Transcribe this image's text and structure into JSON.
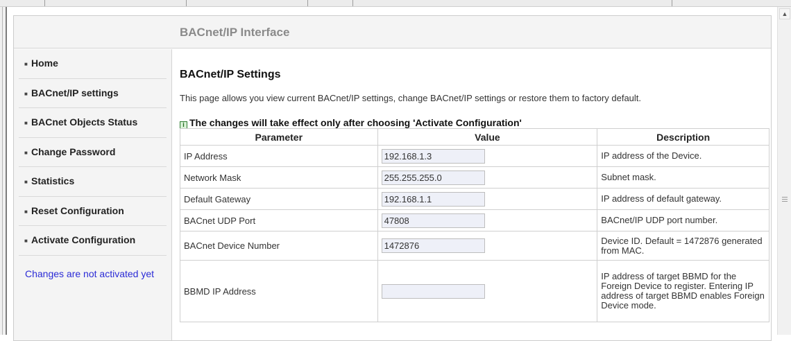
{
  "header": {
    "title": "BACnet/IP Interface"
  },
  "sidebar": {
    "items": [
      {
        "label": "Home"
      },
      {
        "label": "BACnet/IP settings"
      },
      {
        "label": "BACnet Objects Status"
      },
      {
        "label": "Change Password"
      },
      {
        "label": "Statistics"
      },
      {
        "label": "Reset Configuration"
      },
      {
        "label": "Activate Configuration"
      }
    ],
    "status_note": "Changes are not activated yet"
  },
  "main": {
    "section_title": "BACnet/IP Settings",
    "intro": "This page allows you view current BACnet/IP settings, change BACnet/IP settings or restore them to factory default.",
    "notice_icon": "i",
    "notice": "The changes will take effect only after choosing 'Activate Configuration'",
    "table": {
      "headers": {
        "parameter": "Parameter",
        "value": "Value",
        "description": "Description"
      },
      "rows": [
        {
          "parameter": "IP Address",
          "value": "192.168.1.3",
          "description": "IP address of the Device."
        },
        {
          "parameter": "Network Mask",
          "value": "255.255.255.0",
          "description": "Subnet mask."
        },
        {
          "parameter": "Default Gateway",
          "value": "192.168.1.1",
          "description": "IP address of default gateway."
        },
        {
          "parameter": "BACnet UDP Port",
          "value": "47808",
          "description": "BACnet/IP UDP port number."
        },
        {
          "parameter": "BACnet Device Number",
          "value": "1472876",
          "description": "Device ID. Default = 1472876 generated from MAC."
        },
        {
          "parameter": "BBMD IP Address",
          "value": "",
          "description": "IP address of target BBMD for the Foreign Device to register. Entering IP address of target BBMD enables Foreign Device mode."
        }
      ]
    }
  },
  "icons": {
    "scroll_up": "chevron-up-icon",
    "notice": "info-icon",
    "nav_bullet": "bullet-icon"
  },
  "colors": {
    "status_note": "#2b2bd6",
    "header_title": "#8a8a8a",
    "input_bg": "#eef0f8"
  }
}
